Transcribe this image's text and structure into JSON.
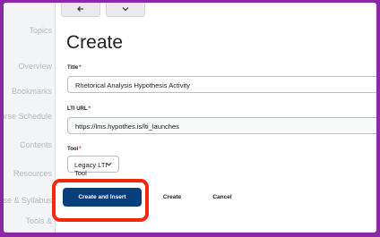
{
  "sidebar": {
    "items": [
      {
        "label": "Topics"
      },
      {
        "label": "Overview"
      },
      {
        "label": "Bookmarks"
      },
      {
        "label": "Course Schedule"
      },
      {
        "label": "Contents"
      },
      {
        "label": "Resources"
      },
      {
        "label": "Course & Syllabus"
      },
      {
        "label": "Tools &"
      }
    ]
  },
  "toolbar": {
    "back_icon": "back-arrow-icon",
    "chevron_icon": "chevron-down-icon"
  },
  "page": {
    "title": "Create"
  },
  "form": {
    "title_label": "Title",
    "title_value": "Rhetorical Analysis Hypothesis Activity",
    "url_label": "LTI URL",
    "url_value": "https://lms.hypothes.is/lti_launches",
    "tool_label": "Tool",
    "tool_value": "Legacy LTI Tool",
    "required_mark": "*"
  },
  "actions": {
    "create_insert": "Create and Insert",
    "create": "Create",
    "cancel": "Cancel"
  },
  "colors": {
    "highlight": "#f4280c",
    "primary": "#073f7d",
    "frame": "#8a28a6"
  }
}
